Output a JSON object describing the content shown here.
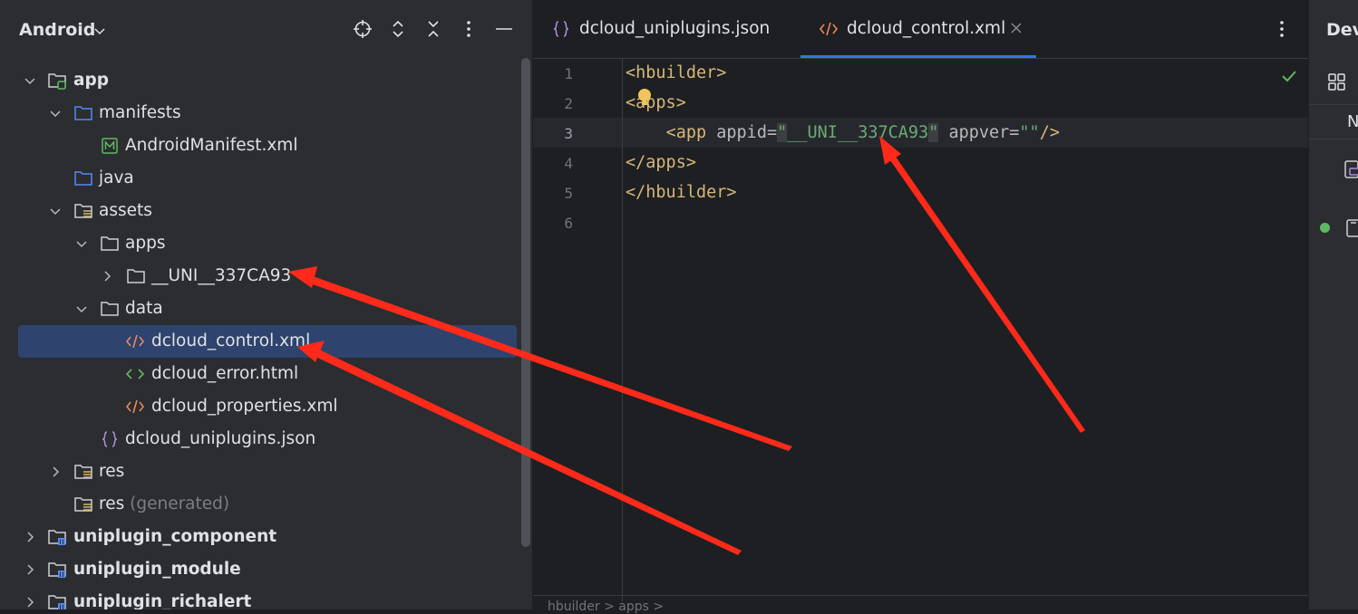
{
  "project_panel": {
    "title": "Android",
    "tree": [
      {
        "label": "app",
        "bold": true
      },
      {
        "label": "manifests"
      },
      {
        "label": "AndroidManifest.xml"
      },
      {
        "label": "java"
      },
      {
        "label": "assets"
      },
      {
        "label": "apps"
      },
      {
        "label": "__UNI__337CA93"
      },
      {
        "label": "data"
      },
      {
        "label": "dcloud_control.xml",
        "selected": true
      },
      {
        "label": "dcloud_error.html"
      },
      {
        "label": "dcloud_properties.xml"
      },
      {
        "label": "dcloud_uniplugins.json"
      },
      {
        "label": "res"
      },
      {
        "label": "res",
        "suffix": "(generated)"
      },
      {
        "label": "uniplugin_component",
        "bold": true
      },
      {
        "label": "uniplugin_module",
        "bold": true
      },
      {
        "label": "uniplugin_richalert",
        "bold": true
      }
    ]
  },
  "editor": {
    "tabs": [
      {
        "label": "dcloud_uniplugins.json",
        "icon": "json-braces-icon"
      },
      {
        "label": "dcloud_control.xml",
        "icon": "xml-code-icon",
        "active": true
      }
    ],
    "line_numbers": [
      "1",
      "2",
      "3",
      "4",
      "5",
      "6"
    ],
    "lines": {
      "l1": {
        "tag": "<hbuilder>"
      },
      "l2": {
        "tag": "<apps>"
      },
      "l3": {
        "open": "<app",
        "attr1": " appid=",
        "val1_q1": "\"",
        "val1": "__UNI__337CA93",
        "val1_q2": "\"",
        "attr2": " appver=",
        "val2": "\"\"",
        "close": "/>"
      },
      "l4": {
        "tag": "</apps>"
      },
      "l5": {
        "tag": "</hbuilder>"
      }
    },
    "breadcrumb": "hbuilder  >  apps  >"
  },
  "right_panel": {
    "title": "Device Manager",
    "column_header": "N"
  },
  "colors": {
    "selection": "#2e436e",
    "tag": "#d5b778",
    "string": "#6aab73",
    "arrow": "#ff2a1a",
    "accent": "#3574f0"
  }
}
